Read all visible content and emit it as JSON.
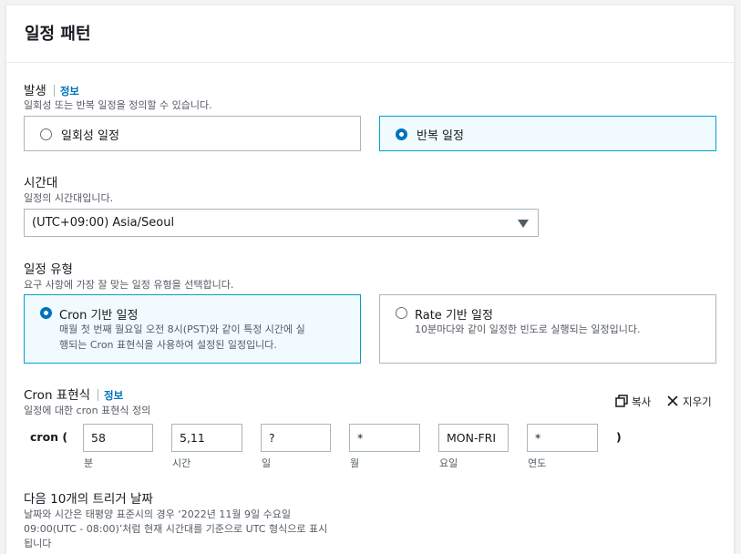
{
  "panel": {
    "title": "일정 패턴"
  },
  "occurrence": {
    "label": "발생",
    "info": "정보",
    "description": "일회성 또는 반복 일정을 정의할 수 있습니다.",
    "options": [
      {
        "label": "일회성 일정",
        "selected": false
      },
      {
        "label": "반복 일정",
        "selected": true
      }
    ]
  },
  "timezone": {
    "label": "시간대",
    "description": "일정의 시간대입니다.",
    "value": "(UTC+09:00) Asia/Seoul"
  },
  "schedule_type": {
    "label": "일정 유형",
    "description": "요구 사항에 가장 잘 맞는 일정 유형을 선택합니다.",
    "options": [
      {
        "label": "Cron 기반 일정",
        "desc1": "매월 첫 번째 월요일 오전 8시(PST)와 같이 특정 시간에 실",
        "desc2": "행되는 Cron 표현식을 사용하여 설정된 일정입니다.",
        "selected": true
      },
      {
        "label": "Rate 기반 일정",
        "desc1": "10분마다와 같이 일정한 빈도로 실행되는 일정입니다.",
        "selected": false
      }
    ]
  },
  "cron": {
    "label": "Cron 표현식",
    "info": "정보",
    "description": "일정에 대한 cron 표현식 정의",
    "copy_label": "복사",
    "clear_label": "지우기",
    "prefix": "cron (",
    "suffix": ")",
    "fields": [
      {
        "value": "58",
        "label": "분"
      },
      {
        "value": "5,11",
        "label": "시간"
      },
      {
        "value": "?",
        "label": "일"
      },
      {
        "value": "*",
        "label": "월"
      },
      {
        "value": "MON-FRI",
        "label": "요일"
      },
      {
        "value": "*",
        "label": "연도"
      }
    ]
  },
  "triggers": {
    "title": "다음 10개의 트리거 날짜",
    "line1": "날짜와 시간은 태평양 표준시의 경우 ‘2022년 11월 9일 수요일",
    "line2": "09:00(UTC - 08:00)’처럼 현재 시간대를 기준으로 UTC 형식으로 표시",
    "line3": "됩니다"
  }
}
